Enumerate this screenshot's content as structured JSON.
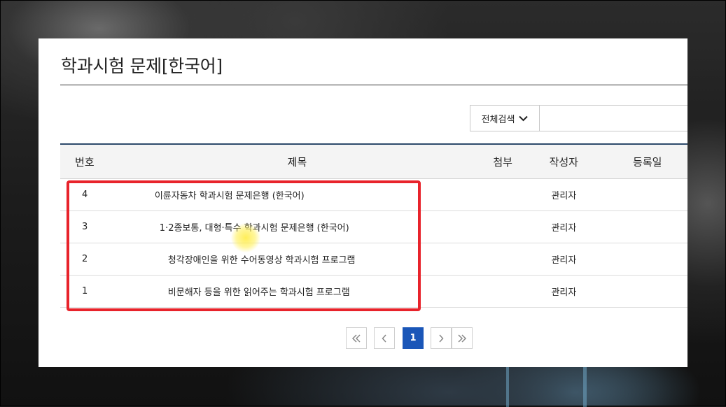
{
  "page": {
    "title": "학과시험 문제[한국어]"
  },
  "search": {
    "scope_label": "전체검색",
    "query": "",
    "placeholder": ""
  },
  "table": {
    "headers": {
      "num": "번호",
      "title": "제목",
      "attachment": "첨부",
      "author": "작성자",
      "date": "등록일"
    },
    "rows": [
      {
        "num": "4",
        "title": "이륜자동차 학과시험 문제은행 (한국어)",
        "attachment": "",
        "author": "관리자",
        "date": ""
      },
      {
        "num": "3",
        "title": "1·2종보통, 대형·특수 학과시험 문제은행 (한국어)",
        "attachment": "",
        "author": "관리자",
        "date": ""
      },
      {
        "num": "2",
        "title": "청각장애인을 위한 수어동영상 학과시험 프로그램",
        "attachment": "",
        "author": "관리자",
        "date": ""
      },
      {
        "num": "1",
        "title": "비문해자 등을 위한 읽어주는 학과시험 프로그램",
        "attachment": "",
        "author": "관리자",
        "date": ""
      }
    ]
  },
  "pagination": {
    "first_icon": "double-chevron-left-icon",
    "prev_icon": "chevron-left-icon",
    "current_page": "1",
    "next_icon": "chevron-right-icon",
    "last_icon": "double-chevron-right-icon"
  },
  "colors": {
    "highlight_border": "#e8232b",
    "active_page": "#1a56b8",
    "header_top_border": "#2d4a6b"
  }
}
